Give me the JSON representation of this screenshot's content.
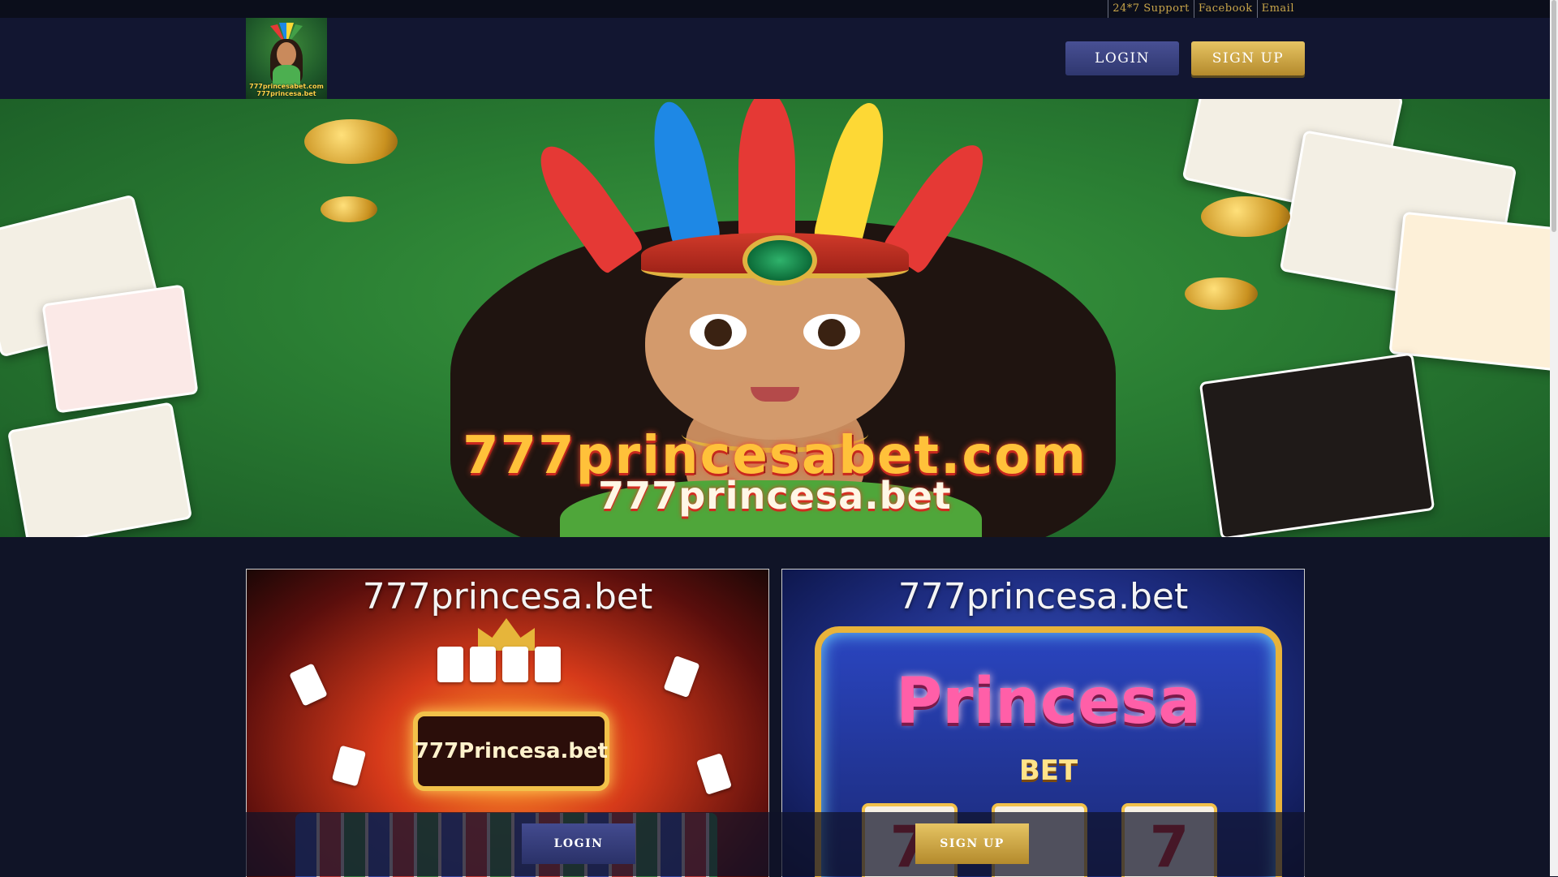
{
  "topbar": {
    "links": [
      "24*7 Support",
      "Facebook",
      "Email"
    ]
  },
  "header": {
    "logo_text": [
      "777princesabet.com",
      "777princesa.bet"
    ],
    "login_label": "LOGIN",
    "signup_label": "SIGN UP"
  },
  "hero": {
    "brand_line1": "777princesabet.com",
    "brand_line2": "777princesa.bet"
  },
  "promos": [
    {
      "title": "777princesa.bet",
      "sign_text": "777Princesa.bet"
    },
    {
      "title": "777princesa.bet",
      "slot_title": "Princesa",
      "slot_sub": "BET",
      "reels": [
        "7",
        "7"
      ]
    }
  ],
  "promo_bar": {
    "login_label": "LOGIN",
    "signup_label": "SIGN UP"
  },
  "colors": {
    "background": "#101427",
    "header": "#121631",
    "gold": "#c9a64a",
    "login_button": "#3b4382",
    "signup_button": "#d2ad4c"
  },
  "icons": [
    "scroll-thumb"
  ]
}
